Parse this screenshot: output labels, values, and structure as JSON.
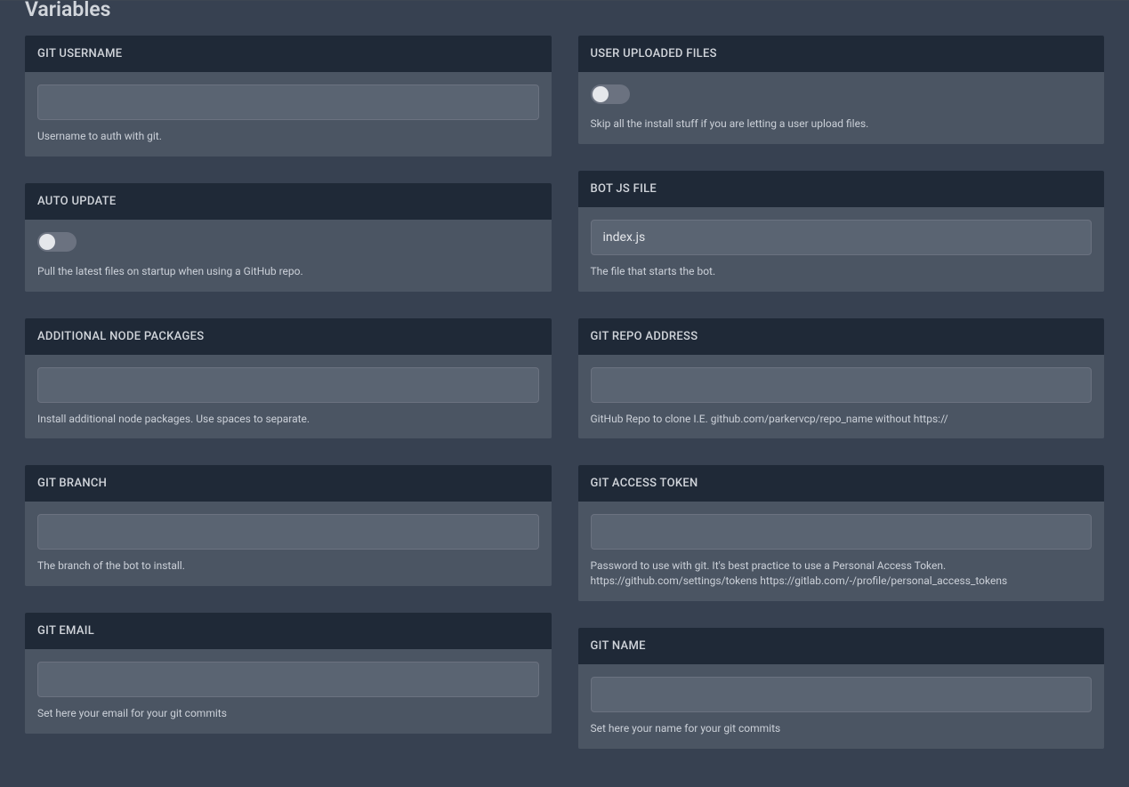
{
  "title": "Variables",
  "left": [
    {
      "key": "git_username",
      "label": "GIT USERNAME",
      "type": "text",
      "value": "",
      "help": "Username to auth with git."
    },
    {
      "key": "auto_update",
      "label": "AUTO UPDATE",
      "type": "toggle",
      "value": false,
      "help": "Pull the latest files on startup when using a GitHub repo."
    },
    {
      "key": "additional_node_packages",
      "label": "ADDITIONAL NODE PACKAGES",
      "type": "text",
      "value": "",
      "help": "Install additional node packages. Use spaces to separate."
    },
    {
      "key": "git_branch",
      "label": "GIT BRANCH",
      "type": "text",
      "value": "",
      "help": "The branch of the bot to install."
    },
    {
      "key": "git_email",
      "label": "GIT EMAIL",
      "type": "text",
      "value": "",
      "help": "Set here your email for your git commits"
    }
  ],
  "right": [
    {
      "key": "user_uploaded_files",
      "label": "USER UPLOADED FILES",
      "type": "toggle",
      "value": false,
      "help": "Skip all the install stuff if you are letting a user upload files."
    },
    {
      "key": "bot_js_file",
      "label": "BOT JS FILE",
      "type": "text",
      "value": "index.js",
      "help": "The file that starts the bot."
    },
    {
      "key": "git_repo_address",
      "label": "GIT REPO ADDRESS",
      "type": "text",
      "value": "",
      "help": "GitHub Repo to clone I.E. github.com/parkervcp/repo_name without https://"
    },
    {
      "key": "git_access_token",
      "label": "GIT ACCESS TOKEN",
      "type": "text",
      "value": "",
      "help": "Password to use with git. It's best practice to use a Personal Access Token. https://github.com/settings/tokens https://gitlab.com/-/profile/personal_access_tokens"
    },
    {
      "key": "git_name",
      "label": "GIT NAME",
      "type": "text",
      "value": "",
      "help": "Set here your name for your git commits"
    }
  ]
}
